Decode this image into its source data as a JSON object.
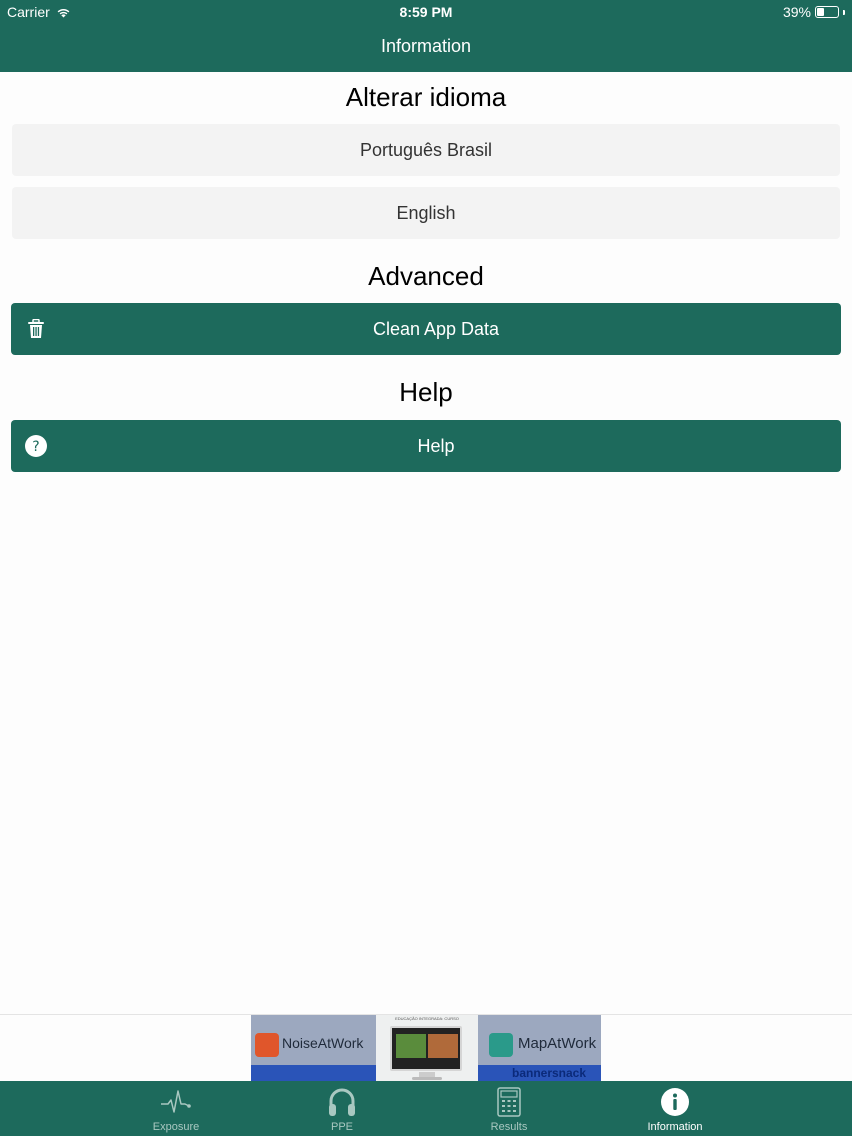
{
  "status_bar": {
    "carrier": "Carrier",
    "time": "8:59 PM",
    "battery": "39%",
    "battery_level": 0.39
  },
  "nav": {
    "title": "Information"
  },
  "language_section": {
    "title": "Alterar idioma",
    "options": [
      "Português Brasil",
      "English"
    ]
  },
  "advanced_section": {
    "title": "Advanced",
    "clean_button": "Clean App Data",
    "clean_icon": "trash-icon"
  },
  "help_section": {
    "title": "Help",
    "help_button": "Help",
    "help_icon": "question-circle-icon"
  },
  "ad_banner": {
    "left_product": "NoiseAtWork",
    "right_product": "MapAtWork",
    "sub_brand": "bannersnack",
    "middle_caption": "EDUCAÇÃO INTEGRADA: CURSO"
  },
  "tab_bar": {
    "tabs": [
      {
        "label": "Exposure",
        "icon": "pulse-icon",
        "active": false
      },
      {
        "label": "PPE",
        "icon": "headphones-icon",
        "active": false
      },
      {
        "label": "Results",
        "icon": "calculator-icon",
        "active": false
      },
      {
        "label": "Information",
        "icon": "info-icon",
        "active": true
      }
    ]
  },
  "colors": {
    "primary": "#1d6a5c",
    "inactive_tab": "#a9c8c1",
    "button_bg": "#f3f3f3"
  }
}
